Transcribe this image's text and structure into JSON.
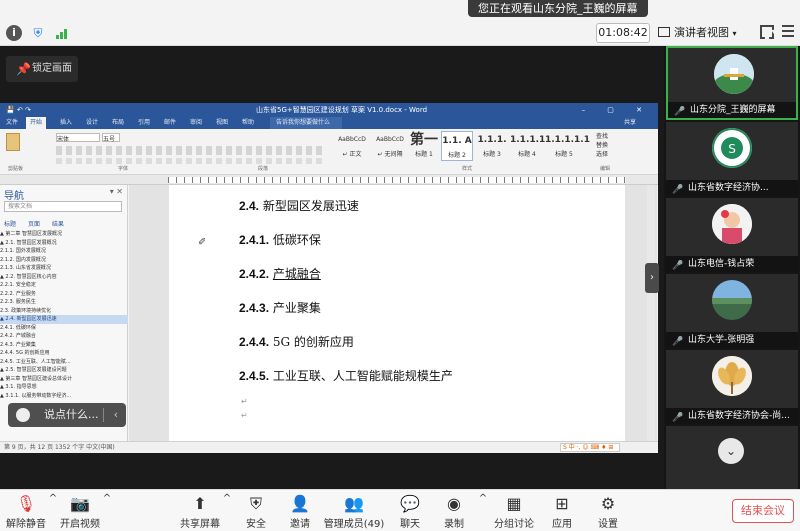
{
  "banner": "您正在观看山东分院_王巍的屏幕",
  "timer": "01:08:42",
  "view_mode": "演讲者视图",
  "lock_label": "锁定画面",
  "word": {
    "title": "山东省5G+智慧园区建设规划 草案 V1.0.docx - Word",
    "tabs": [
      "文件",
      "开始",
      "插入",
      "设计",
      "布局",
      "引用",
      "邮件",
      "审阅",
      "视图",
      "帮助"
    ],
    "tell_me": "告诉我你想要做什么",
    "share": "共享",
    "font_name": "宋体",
    "font_size": "五号",
    "styles": [
      {
        "preview": "AaBbCcD",
        "name": "↵ 正文"
      },
      {
        "preview": "AaBbCcD",
        "name": "↵ 无间隔"
      },
      {
        "preview": "第一",
        "name": "标题 1"
      },
      {
        "preview": "1.1. A",
        "name": "标题 2"
      },
      {
        "preview": "1.1.1.",
        "name": "标题 3"
      },
      {
        "preview": "1.1.1.1",
        "name": "标题 4"
      },
      {
        "preview": "1.1.1.1.1",
        "name": "标题 5"
      }
    ],
    "find": "查找",
    "replace": "替换",
    "select": "选择",
    "groups": [
      "剪贴板",
      "字体",
      "段落",
      "样式",
      "编辑"
    ],
    "nav_title": "导航",
    "nav_search": "搜索文档",
    "nav_tabs": [
      "标题",
      "页面",
      "结果"
    ],
    "nav_items": [
      "▲ 第二章 智慧园区发展概况",
      "  ▲ 2.1. 智慧园区发展概况",
      "      2.1.1. 国外发展概况",
      "      2.1.2. 国内发展概况",
      "      2.1.3. 山东省发展概况",
      "  ▲ 2.2. 智慧园区核心内容",
      "      2.2.1. 安全稳定",
      "      2.2.2. 产业服务",
      "      2.2.3. 服务民生",
      "    2.3. 政策环境持续优化",
      "  ▲ 2.4. 新型园区发展迅速",
      "      2.4.1. 低碳环保",
      "      2.4.2. 产城融合",
      "      2.4.3. 产业聚集",
      "      2.4.4. 5G 的创新应用",
      "      2.4.5. 工业互联、人工智能赋...",
      "  ▲ 2.5. 智慧园区发展建设问题",
      "▲ 第三章 智慧园区建设总体设计",
      "  ▲ 3.1. 指导思想",
      "    ▲ 3.1.1. 以服务带动数字经济..."
    ],
    "headings": [
      {
        "num": "2.4.",
        "text": "新型园区发展迅速"
      },
      {
        "num": "2.4.1.",
        "text": "低碳环保"
      },
      {
        "num": "2.4.2.",
        "text": "产城融合"
      },
      {
        "num": "2.4.3.",
        "text": "产业聚集"
      },
      {
        "num": "2.4.4.",
        "text": "5G 的创新应用"
      },
      {
        "num": "2.4.5.",
        "text": "工业互联、人工智能赋能规模生产"
      }
    ],
    "status": "第 9 页，共 12 页    1352 个字    中文(中国)",
    "ime": "S 中 ·, ☺ ⌨ ♦ ⊞"
  },
  "comment_placeholder": "说点什么...",
  "participants": [
    {
      "name": "山东分院_王巍的屏幕",
      "mic": "muted"
    },
    {
      "name": "山东省数字经济协...",
      "mic": "muted"
    },
    {
      "name": "山东电信-钱占荣",
      "mic": "muted"
    },
    {
      "name": "山东大学-张明强",
      "mic": "muted"
    },
    {
      "name": "山东省数字经济协会-尚...",
      "mic": "muted"
    }
  ],
  "toolbar": {
    "unmute": "解除静音",
    "start_video": "开启视频",
    "share_screen": "共享屏幕",
    "security": "安全",
    "invite": "邀请",
    "members": "管理成员(49)",
    "chat": "聊天",
    "record": "录制",
    "breakout": "分组讨论",
    "apps": "应用",
    "settings": "设置",
    "end": "结束会议"
  }
}
